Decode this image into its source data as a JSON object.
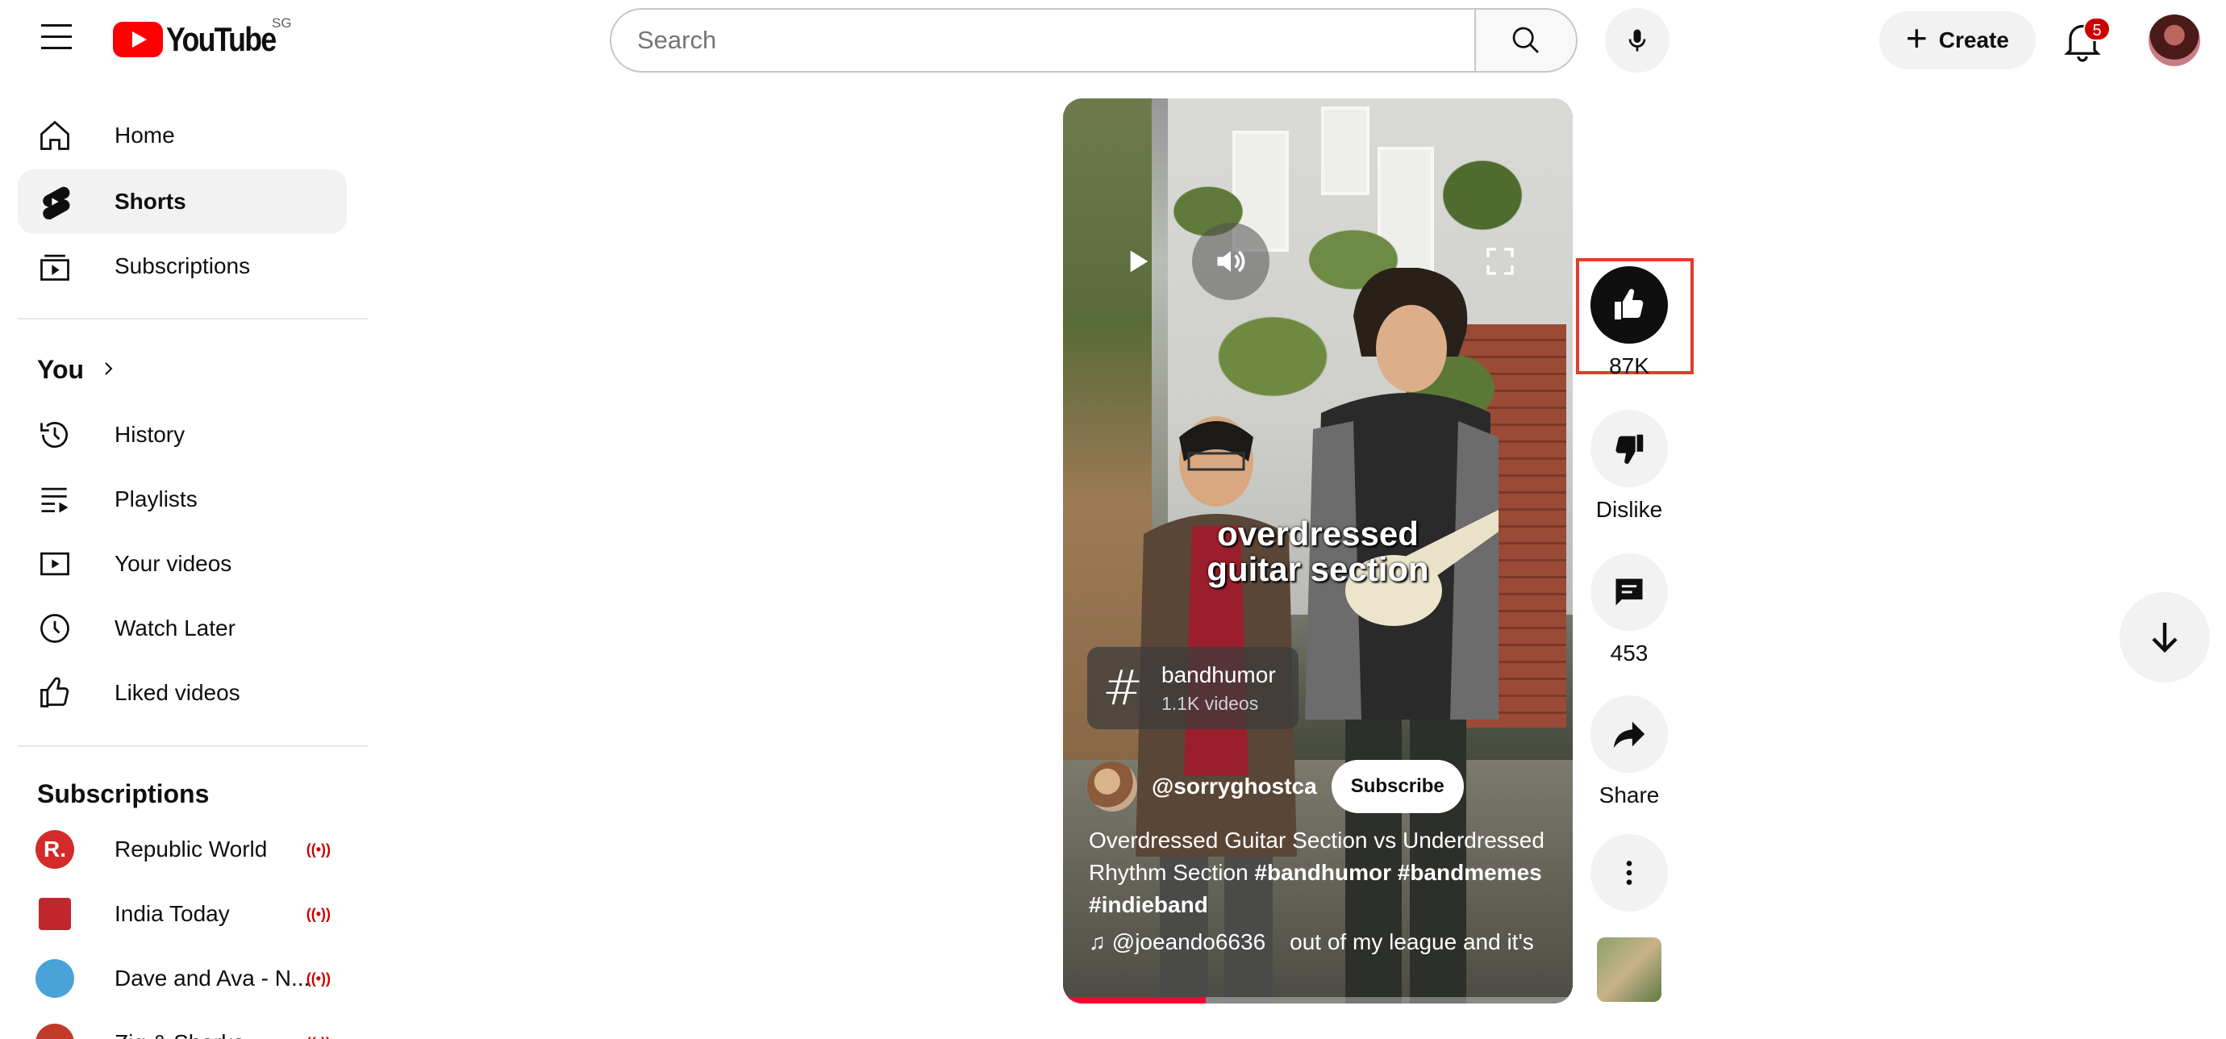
{
  "header": {
    "menu_icon": "hamburger-menu-icon",
    "logo_text": "YouTube",
    "region": "SG",
    "search_placeholder": "Search",
    "create_label": "Create",
    "notifications_count": "5"
  },
  "sidebar": {
    "main": [
      {
        "label": "Home",
        "icon": "home-icon"
      },
      {
        "label": "Shorts",
        "icon": "shorts-icon",
        "active": true
      },
      {
        "label": "Subscriptions",
        "icon": "subscriptions-icon"
      }
    ],
    "you_title": "You",
    "you_items": [
      {
        "label": "History",
        "icon": "history-icon"
      },
      {
        "label": "Playlists",
        "icon": "playlists-icon"
      },
      {
        "label": "Your videos",
        "icon": "your-videos-icon"
      },
      {
        "label": "Watch Later",
        "icon": "watch-later-icon"
      },
      {
        "label": "Liked videos",
        "icon": "liked-videos-icon"
      }
    ],
    "subscriptions_title": "Subscriptions",
    "subscriptions": [
      {
        "label": "Republic World",
        "live": true,
        "avatar_color": "#d42a2a",
        "avatar_text": "R."
      },
      {
        "label": "India Today",
        "live": true,
        "avatar_color": "#c0272d",
        "avatar_text": ""
      },
      {
        "label": "Dave and Ava - N...",
        "live": true,
        "avatar_color": "#4aa3d8",
        "avatar_text": ""
      },
      {
        "label": "Zig & Sharko",
        "live": true,
        "avatar_color": "#c23a2a",
        "avatar_text": ""
      }
    ]
  },
  "short": {
    "overlay_line1": "overdressed",
    "overlay_line2": "guitar section",
    "hashtag_name": "bandhumor",
    "hashtag_count": "1.1K videos",
    "channel": "@sorryghostca",
    "subscribe_label": "Subscribe",
    "description_plain": "Overdressed Guitar Section vs Underdressed Rhythm Section ",
    "description_tags": "#bandhumor #bandmemes #indieband",
    "music_artist": "@joeando6636",
    "music_track": "out of my league and it's",
    "progress_fraction": 0.28
  },
  "actions": {
    "like_count": "87K",
    "dislike_label": "Dislike",
    "comment_count": "453",
    "share_label": "Share"
  },
  "colors": {
    "brand_red": "#ff0000",
    "highlight": "#e23d2a",
    "progress": "#ff0033"
  }
}
